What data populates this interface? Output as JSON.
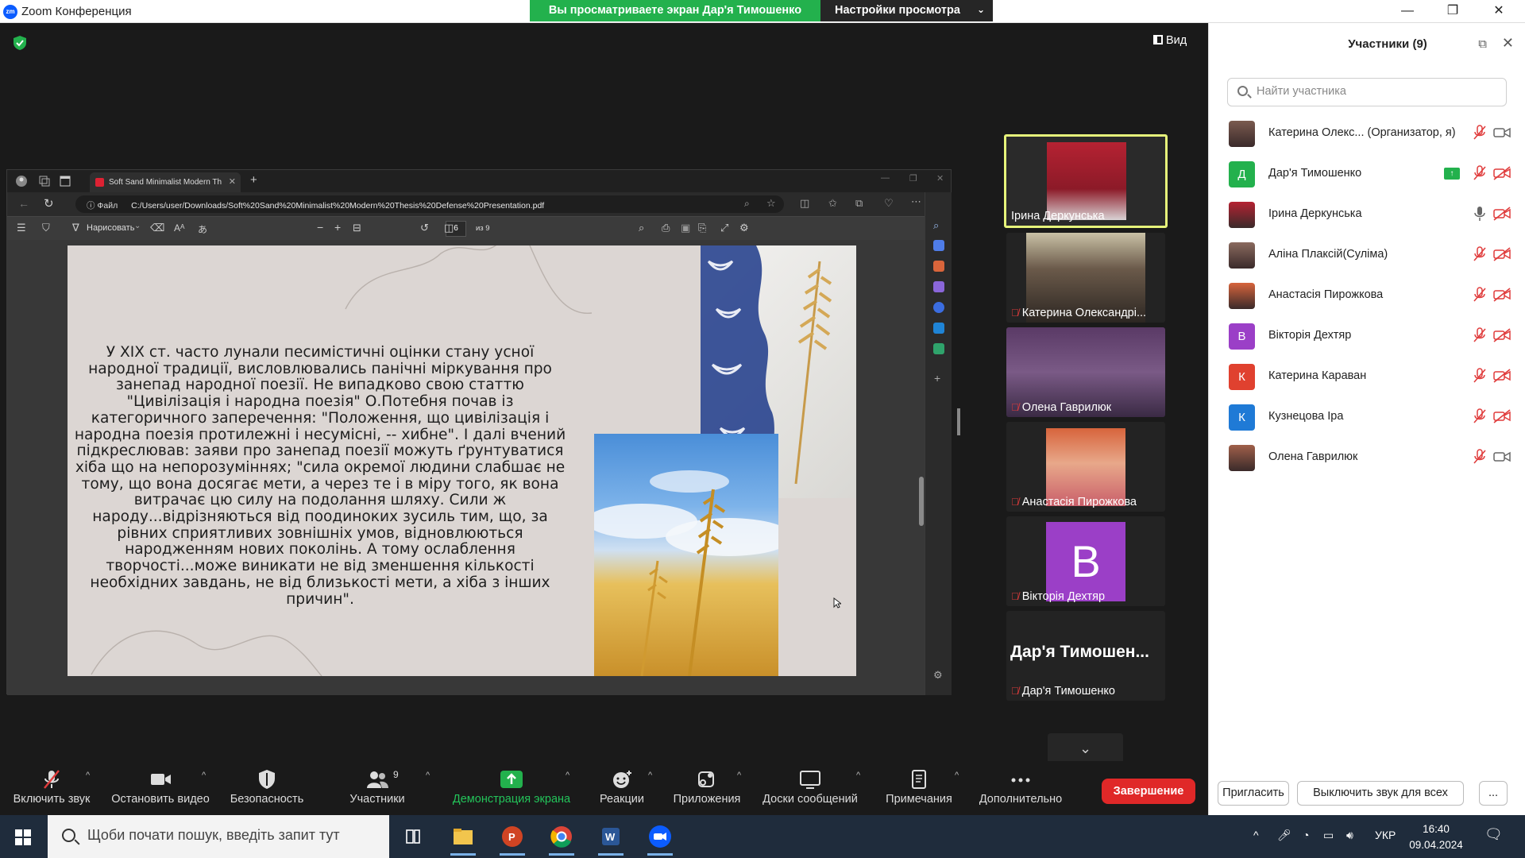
{
  "window": {
    "app_title": "Zoom Конференция",
    "app_logo": "zm",
    "share_banner": "Вы просматриваете экран Дар'я Тимошенко",
    "view_settings": "Настройки просмотра"
  },
  "meeting": {
    "view_label": "Вид"
  },
  "browser": {
    "tab_title": "Soft Sand Minimalist Modern Th",
    "url_prefix": "Файл",
    "url": "C:/Users/user/Downloads/Soft%20Sand%20Minimalist%20Modern%20Thesis%20Defense%20Presentation.pdf",
    "draw_label": "Нарисовать",
    "page_number": "6",
    "page_of": "из 9"
  },
  "slide": {
    "paragraph": "У XIX ст. часто лунали песимістичні оцінки стану усної народної традиції, висловлювались панічні міркування про занепад народної поезії. Не випадково свою статтю \"Цивілізація і народна поезія\" О.Потебня почав із категоричного заперечення: \"Положення, що цивілізація і народна поезія протилежні і несумісні, -- хибне\". І далі вчений підкреслював: заяви про занепад поезії можуть ґрунтуватися хіба що на непорозуміннях; \"сила окремої людини слабшає не тому, що вона досягає мети, а через те і в міру того, як вона витрачає цю силу на подолання шляху. Сили ж народу...відрізняються від поодиноких зусиль тим, що, за рівних сприятливих зовнішніх умов, відновлюються народженням нових поколінь. А тому ослаблення творчості...може виникати не від зменшення кількості необхідних завдань, не від близькості мети, а хіба з інших причин\"."
  },
  "tiles": [
    {
      "name": "Ірина Деркунська",
      "muted": false
    },
    {
      "name": "Катерина Олександрі...",
      "muted": true
    },
    {
      "name": "Олена Гаврилюк",
      "muted": true
    },
    {
      "name": "Анастасія Пирожкова",
      "muted": true
    },
    {
      "name": "Вікторія Дехтяр",
      "muted": true,
      "letter": "В"
    },
    {
      "name": "Дар'я Тимошенко",
      "muted": true,
      "big_name": "Дар'я Тимошен..."
    }
  ],
  "toolbar": {
    "unmute": "Включить звук",
    "stop_video": "Остановить видео",
    "security": "Безопасность",
    "participants": "Участники",
    "participants_count": "9",
    "share_screen": "Демонстрация экрана",
    "reactions": "Реакции",
    "apps": "Приложения",
    "whiteboards": "Доски сообщений",
    "notes": "Примечания",
    "more": "Дополнительно",
    "end": "Завершение"
  },
  "panel": {
    "title": "Участники (9)",
    "search_placeholder": "Найти участника",
    "participants": [
      {
        "name": "Катерина Олекс... (Организатор, я)",
        "avatar": "photo",
        "mic": "muted",
        "cam": "on"
      },
      {
        "name": "Дар'я Тимошенко",
        "avatar": "Д",
        "color": "#23b14d",
        "sharing": true,
        "mic": "muted",
        "cam": "off"
      },
      {
        "name": "Ірина Деркунська",
        "avatar": "photo",
        "mic": "on",
        "cam": "off"
      },
      {
        "name": "Аліна Плаксій(Суліма)",
        "avatar": "photo",
        "mic": "muted",
        "cam": "off"
      },
      {
        "name": "Анастасія Пирожкова",
        "avatar": "photo",
        "mic": "muted",
        "cam": "off"
      },
      {
        "name": "Вікторія Дехтяр",
        "avatar": "В",
        "color": "#9b3fc7",
        "mic": "muted",
        "cam": "off"
      },
      {
        "name": "Катерина Караван",
        "avatar": "К",
        "color": "#e0412f",
        "mic": "muted",
        "cam": "off"
      },
      {
        "name": "Кузнецова Іра",
        "avatar": "К",
        "color": "#1f7ad6",
        "mic": "muted",
        "cam": "off"
      },
      {
        "name": "Олена Гаврилюк",
        "avatar": "photo",
        "mic": "muted",
        "cam": "on"
      }
    ],
    "invite": "Пригласить",
    "mute_all": "Выключить звук для всех",
    "more": "..."
  },
  "taskbar": {
    "search_placeholder": "Щоби почати пошук, введіть запит тут",
    "lang": "УКР",
    "time": "16:40",
    "date": "09.04.2024"
  }
}
